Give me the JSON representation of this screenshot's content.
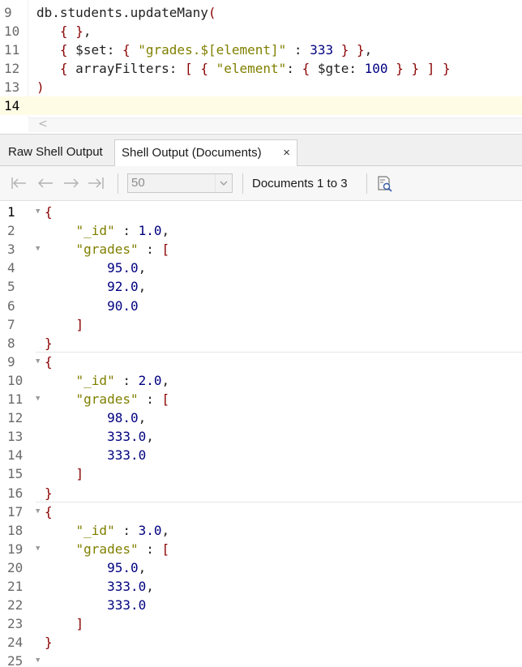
{
  "editor": {
    "lines": [
      {
        "num": "9",
        "tokens": [
          {
            "t": "db.students.updateMany",
            "c": "p"
          },
          {
            "t": "(",
            "c": "k"
          }
        ]
      },
      {
        "num": "10",
        "tokens": [
          {
            "t": "   ",
            "c": "p"
          },
          {
            "t": "{",
            "c": "k"
          },
          {
            "t": " ",
            "c": "p"
          },
          {
            "t": "}",
            "c": "k"
          },
          {
            "t": ",",
            "c": "p"
          }
        ]
      },
      {
        "num": "11",
        "tokens": [
          {
            "t": "   ",
            "c": "p"
          },
          {
            "t": "{",
            "c": "k"
          },
          {
            "t": " $set: ",
            "c": "p"
          },
          {
            "t": "{",
            "c": "k"
          },
          {
            "t": " ",
            "c": "p"
          },
          {
            "t": "\"grades.$[element]\"",
            "c": "s"
          },
          {
            "t": " : ",
            "c": "p"
          },
          {
            "t": "333",
            "c": "n"
          },
          {
            "t": " ",
            "c": "p"
          },
          {
            "t": "}",
            "c": "k"
          },
          {
            "t": " ",
            "c": "p"
          },
          {
            "t": "}",
            "c": "k"
          },
          {
            "t": ",",
            "c": "p"
          }
        ]
      },
      {
        "num": "12",
        "tokens": [
          {
            "t": "   ",
            "c": "p"
          },
          {
            "t": "{",
            "c": "k"
          },
          {
            "t": " arrayFilters: ",
            "c": "p"
          },
          {
            "t": "[",
            "c": "k"
          },
          {
            "t": " ",
            "c": "p"
          },
          {
            "t": "{",
            "c": "k"
          },
          {
            "t": " ",
            "c": "p"
          },
          {
            "t": "\"element\"",
            "c": "s"
          },
          {
            "t": ": ",
            "c": "p"
          },
          {
            "t": "{",
            "c": "k"
          },
          {
            "t": " $gte: ",
            "c": "p"
          },
          {
            "t": "100",
            "c": "n"
          },
          {
            "t": " ",
            "c": "p"
          },
          {
            "t": "}",
            "c": "k"
          },
          {
            "t": " ",
            "c": "p"
          },
          {
            "t": "}",
            "c": "k"
          },
          {
            "t": " ",
            "c": "p"
          },
          {
            "t": "]",
            "c": "k"
          },
          {
            "t": " ",
            "c": "p"
          },
          {
            "t": "}",
            "c": "k"
          }
        ]
      },
      {
        "num": "13",
        "tokens": [
          {
            "t": ")",
            "c": "k"
          }
        ]
      },
      {
        "num": "14",
        "tokens": [],
        "current": true
      }
    ],
    "scroll_glyph": "<"
  },
  "tabs": [
    {
      "id": "raw",
      "label": "Raw Shell Output",
      "active": false
    },
    {
      "id": "docs",
      "label": "Shell Output (Documents)",
      "active": true,
      "close": "×"
    }
  ],
  "toolbar": {
    "page_size": "50",
    "doc_range": "Documents 1 to 3",
    "icons": [
      "first-page-icon",
      "previous-page-icon",
      "next-page-icon",
      "last-page-icon",
      "chevron-down-icon",
      "find-in-document-icon"
    ]
  },
  "results": {
    "lines": [
      {
        "num": "1",
        "fold": true,
        "tokens": [
          {
            "t": "{",
            "c": "k"
          }
        ]
      },
      {
        "num": "2",
        "tokens": [
          {
            "t": "    ",
            "c": "p"
          },
          {
            "t": "\"_id\"",
            "c": "s"
          },
          {
            "t": " : ",
            "c": "p"
          },
          {
            "t": "1.0",
            "c": "n"
          },
          {
            "t": ",",
            "c": "p"
          }
        ]
      },
      {
        "num": "3",
        "fold": true,
        "tokens": [
          {
            "t": "    ",
            "c": "p"
          },
          {
            "t": "\"grades\"",
            "c": "s"
          },
          {
            "t": " : ",
            "c": "p"
          },
          {
            "t": "[",
            "c": "k"
          }
        ]
      },
      {
        "num": "4",
        "tokens": [
          {
            "t": "        ",
            "c": "p"
          },
          {
            "t": "95.0",
            "c": "n"
          },
          {
            "t": ",",
            "c": "p"
          }
        ]
      },
      {
        "num": "5",
        "tokens": [
          {
            "t": "        ",
            "c": "p"
          },
          {
            "t": "92.0",
            "c": "n"
          },
          {
            "t": ",",
            "c": "p"
          }
        ]
      },
      {
        "num": "6",
        "tokens": [
          {
            "t": "        ",
            "c": "p"
          },
          {
            "t": "90.0",
            "c": "n"
          }
        ]
      },
      {
        "num": "7",
        "tokens": [
          {
            "t": "    ",
            "c": "p"
          },
          {
            "t": "]",
            "c": "k"
          }
        ]
      },
      {
        "num": "8",
        "tokens": [
          {
            "t": "}",
            "c": "k"
          }
        ],
        "sep_after": true
      },
      {
        "num": "9",
        "fold": true,
        "tokens": [
          {
            "t": "{",
            "c": "k"
          }
        ]
      },
      {
        "num": "10",
        "tokens": [
          {
            "t": "    ",
            "c": "p"
          },
          {
            "t": "\"_id\"",
            "c": "s"
          },
          {
            "t": " : ",
            "c": "p"
          },
          {
            "t": "2.0",
            "c": "n"
          },
          {
            "t": ",",
            "c": "p"
          }
        ]
      },
      {
        "num": "11",
        "fold": true,
        "tokens": [
          {
            "t": "    ",
            "c": "p"
          },
          {
            "t": "\"grades\"",
            "c": "s"
          },
          {
            "t": " : ",
            "c": "p"
          },
          {
            "t": "[",
            "c": "k"
          }
        ]
      },
      {
        "num": "12",
        "tokens": [
          {
            "t": "        ",
            "c": "p"
          },
          {
            "t": "98.0",
            "c": "n"
          },
          {
            "t": ",",
            "c": "p"
          }
        ]
      },
      {
        "num": "13",
        "tokens": [
          {
            "t": "        ",
            "c": "p"
          },
          {
            "t": "333.0",
            "c": "n"
          },
          {
            "t": ",",
            "c": "p"
          }
        ]
      },
      {
        "num": "14",
        "tokens": [
          {
            "t": "        ",
            "c": "p"
          },
          {
            "t": "333.0",
            "c": "n"
          }
        ]
      },
      {
        "num": "15",
        "tokens": [
          {
            "t": "    ",
            "c": "p"
          },
          {
            "t": "]",
            "c": "k"
          }
        ]
      },
      {
        "num": "16",
        "tokens": [
          {
            "t": "}",
            "c": "k"
          }
        ],
        "sep_after": true
      },
      {
        "num": "17",
        "fold": true,
        "tokens": [
          {
            "t": "{",
            "c": "k"
          }
        ]
      },
      {
        "num": "18",
        "tokens": [
          {
            "t": "    ",
            "c": "p"
          },
          {
            "t": "\"_id\"",
            "c": "s"
          },
          {
            "t": " : ",
            "c": "p"
          },
          {
            "t": "3.0",
            "c": "n"
          },
          {
            "t": ",",
            "c": "p"
          }
        ]
      },
      {
        "num": "19",
        "fold": true,
        "tokens": [
          {
            "t": "    ",
            "c": "p"
          },
          {
            "t": "\"grades\"",
            "c": "s"
          },
          {
            "t": " : ",
            "c": "p"
          },
          {
            "t": "[",
            "c": "k"
          }
        ]
      },
      {
        "num": "20",
        "tokens": [
          {
            "t": "        ",
            "c": "p"
          },
          {
            "t": "95.0",
            "c": "n"
          },
          {
            "t": ",",
            "c": "p"
          }
        ]
      },
      {
        "num": "21",
        "tokens": [
          {
            "t": "        ",
            "c": "p"
          },
          {
            "t": "333.0",
            "c": "n"
          },
          {
            "t": ",",
            "c": "p"
          }
        ]
      },
      {
        "num": "22",
        "tokens": [
          {
            "t": "        ",
            "c": "p"
          },
          {
            "t": "333.0",
            "c": "n"
          }
        ]
      },
      {
        "num": "23",
        "tokens": [
          {
            "t": "    ",
            "c": "p"
          },
          {
            "t": "]",
            "c": "k"
          }
        ]
      },
      {
        "num": "24",
        "tokens": [
          {
            "t": "}",
            "c": "k"
          }
        ]
      },
      {
        "num": "25",
        "fold": true,
        "tokens": []
      }
    ]
  },
  "colors": {
    "bracket": "#8b0000",
    "string": "#7f7f00",
    "number": "#000080",
    "current_line": "#fffce6"
  }
}
